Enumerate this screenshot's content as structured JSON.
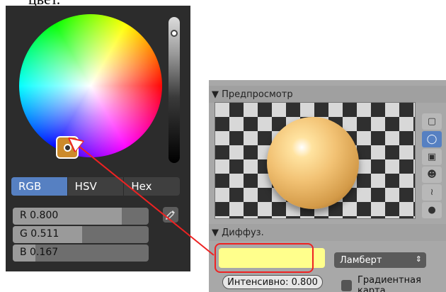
{
  "caption_fragment": "цвет.",
  "picker": {
    "tabs": [
      {
        "label": "RGB",
        "active": true
      },
      {
        "label": "HSV",
        "active": false
      },
      {
        "label": "Hex",
        "active": false
      }
    ],
    "values": [
      {
        "label": "R 0.800",
        "level": 0.8
      },
      {
        "label": "G 0.511",
        "level": 0.511
      },
      {
        "label": "B 0.167",
        "level": 0.167
      }
    ],
    "eyedropper_icon": "eyedropper-icon"
  },
  "material": {
    "preview_header": "▼ Предпросмотр",
    "diffuse_header": "▼ Диффуз.",
    "diffuse_color": "#ffff8c",
    "shader_select": "Ламберт",
    "intensity": "Интенсивно: 0.800",
    "ramp_checkbox": "Градиентная карта",
    "preview_shapes": [
      "plane-icon",
      "sphere-icon",
      "cube-icon",
      "monkey-icon",
      "hair-icon",
      "sphere-light-icon"
    ]
  },
  "colors": {
    "accent": "#5680c2",
    "highlight": "#ee2222"
  }
}
